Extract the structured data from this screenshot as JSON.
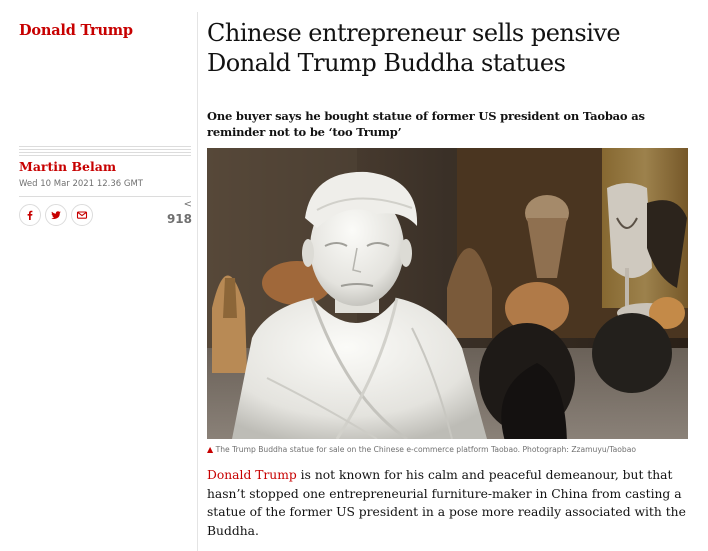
{
  "section": {
    "tag": "Donald Trump"
  },
  "byline": {
    "author": "Martin Belam",
    "date": "Wed 10 Mar 2021 12.36 GMT"
  },
  "share": {
    "buttons": [
      {
        "name": "facebook",
        "icon": "facebook-icon"
      },
      {
        "name": "twitter",
        "icon": "twitter-icon"
      },
      {
        "name": "email",
        "icon": "email-icon"
      }
    ],
    "count": "918",
    "count_icon": "share-arrow-icon"
  },
  "article": {
    "headline": "Chinese entrepreneur sells pensive Donald Trump Buddha statues",
    "standfirst": "One buyer says he bought statue of former US president on Taobao as reminder not to be ‘too Trump’",
    "caption": "The Trump Buddha statue for sale on the Chinese e-commerce platform Taobao. Photograph: Zzamuyu/Taobao",
    "body_link": "Donald Trump",
    "body_rest": " is not known for his calm and peaceful demeanour, but that hasn’t stopped one entrepreneurial furniture-maker in China from casting a statue of the former US president in a pose more readily associated with the Buddha."
  },
  "colors": {
    "accent": "#c70000",
    "text": "#121212",
    "muted": "#707070"
  }
}
